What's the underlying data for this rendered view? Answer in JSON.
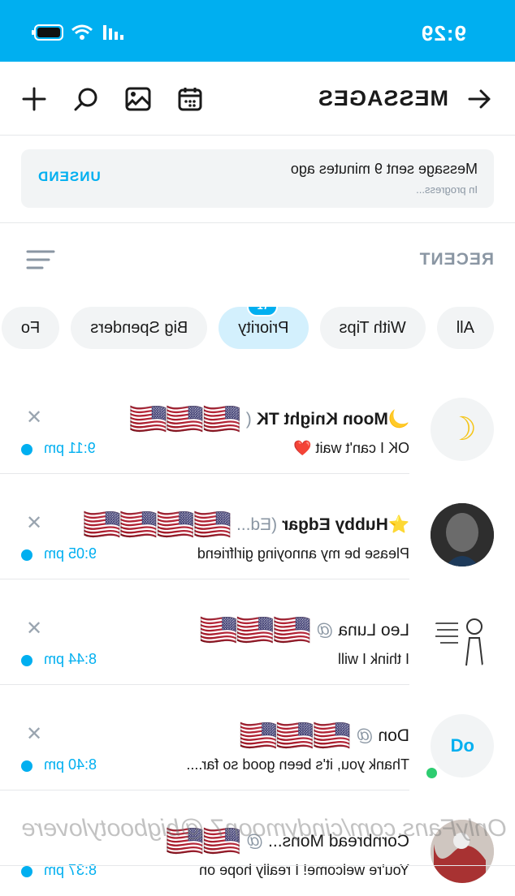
{
  "status_bar": {
    "time": "9:29"
  },
  "header": {
    "title": "MESSAGES"
  },
  "in_progress": {
    "message": "Message sent 9 minutes ago",
    "status": "In progress...",
    "unsend_label": "UNSEND"
  },
  "section": {
    "label": "RECENT"
  },
  "filters": {
    "chips": [
      "All",
      "With Tips",
      "Priority",
      "Big Spenders",
      "Fo"
    ],
    "priority_badge": "17"
  },
  "conversations": [
    {
      "name": "🌙Moon Knight TK",
      "handle": "(",
      "flags": "🇺🇸🇺🇸🇺🇸",
      "preview": "OK I can't wait ❤️",
      "time": "9:11 pm"
    },
    {
      "name": "⭐Hubby Edgar",
      "handle": "(Ed...",
      "flags": "🇺🇸🇺🇸🇺🇸🇺🇸",
      "preview": "Please be my annoying girlfriend",
      "time": "9:05 pm"
    },
    {
      "name": "Leo Luna",
      "handle": "@",
      "flags": "🇺🇸🇺🇸🇺🇸",
      "preview": "I think I will",
      "time": "8:44 pm"
    },
    {
      "name": "Don",
      "handle": "@",
      "flags": "🇺🇸🇺🇸🇺🇸",
      "preview": "Thank you, it's been good so far....",
      "time": "8:40 pm",
      "avatar_initials": "Do"
    },
    {
      "name": "Cornbread Mons...",
      "handle": "@",
      "flags": "🇺🇸🇺🇸",
      "preview": "You're welcome! I really hope on",
      "time": "8:37 pm"
    }
  ],
  "watermark": "OnlyFans.com/cindymoon7 @bigbootylovere"
}
